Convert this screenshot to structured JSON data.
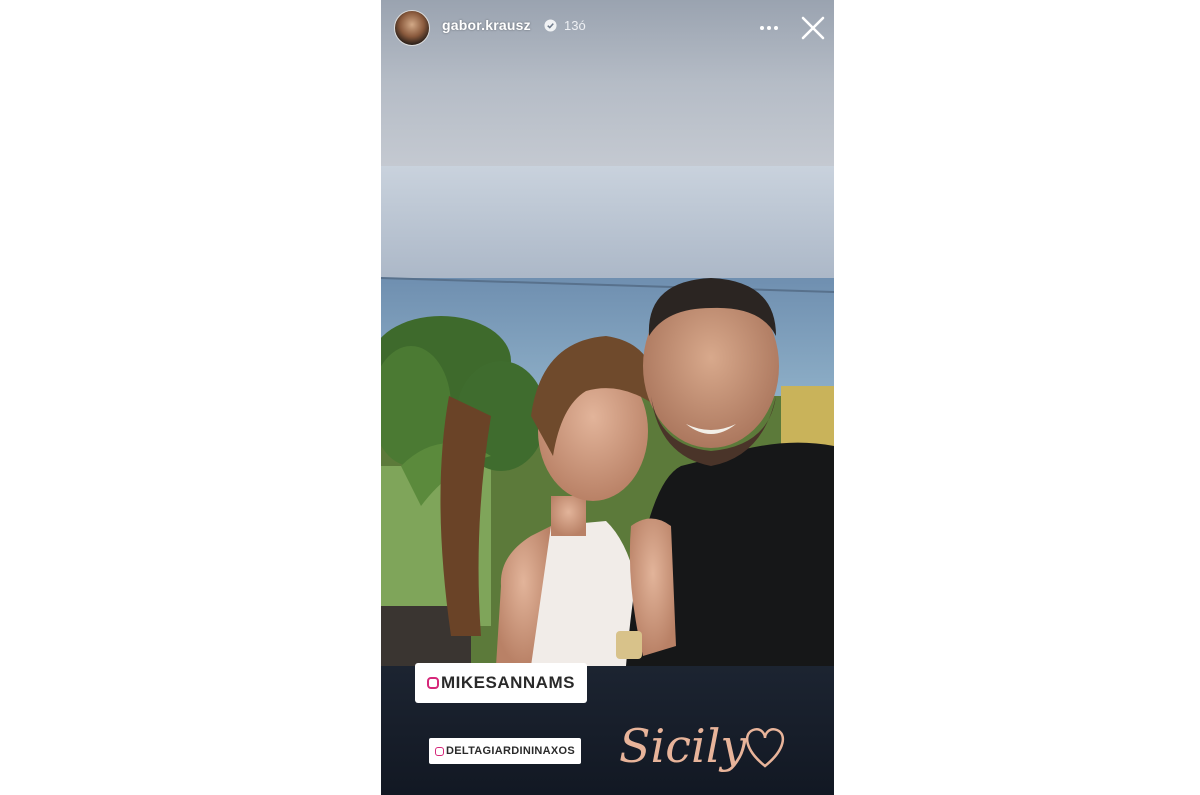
{
  "story": {
    "username": "gabor.krausz",
    "time": "13ó",
    "verified": true,
    "more_icon": "more-horizontal-icon",
    "close_icon": "close-icon"
  },
  "mentions": [
    {
      "label": "MIKESANNAMS"
    },
    {
      "label": "DELTAGIARDININAXOS"
    }
  ],
  "sticker": {
    "text": "Sicily",
    "icon": "heart-icon",
    "color": "#e8b49a"
  }
}
